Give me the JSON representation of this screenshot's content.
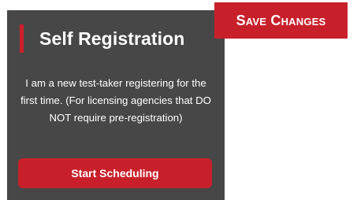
{
  "card": {
    "title": "Self Registration",
    "description": "I am a new test-taker registering for the first time. (For licensing agencies that DO NOT require pre-registration)",
    "button_label": "Start Scheduling"
  },
  "toolbar": {
    "save_label": "Save Changes"
  },
  "colors": {
    "accent": "#cc1f2b",
    "card_background": "#474747",
    "button_red": "#c8202b"
  }
}
